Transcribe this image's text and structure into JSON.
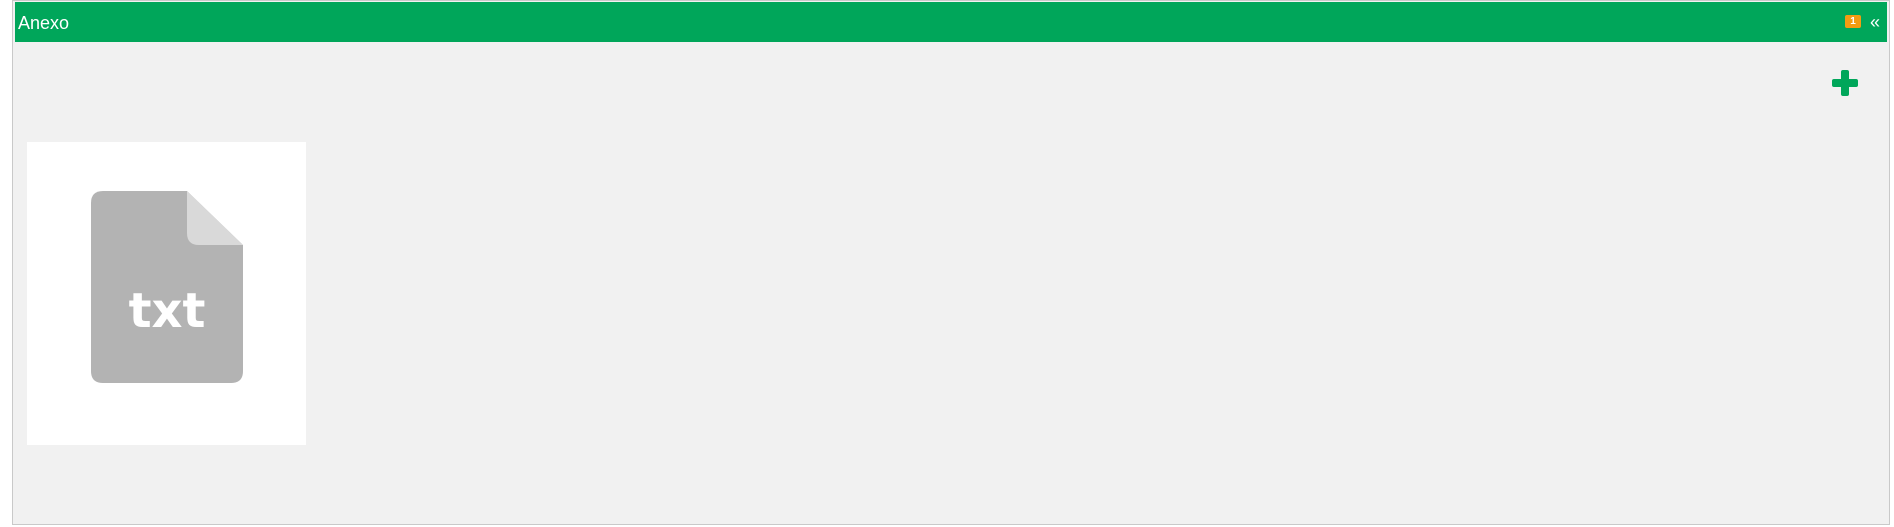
{
  "panel": {
    "title": "Anexo",
    "badge_count": "1",
    "collapse_symbol": "«"
  },
  "actions": {
    "add_icon": "plus-icon"
  },
  "attachments": [
    {
      "extension": "txt",
      "icon": "txt-file-icon"
    }
  ],
  "colors": {
    "header": "#00a65a",
    "badge": "#f39c12",
    "body": "#f1f1f1",
    "file_icon": "#b3b3b3",
    "file_fold": "#d9d9d9"
  }
}
